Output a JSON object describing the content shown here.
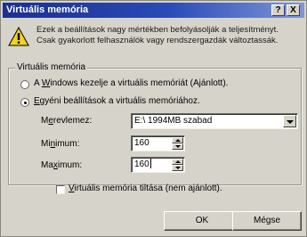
{
  "window": {
    "title": "Virtuális memória",
    "help_button": "?",
    "close_button": "X"
  },
  "message": {
    "icon": "warning-icon",
    "text": "Ezek a beállítások nagy mértékben befolyásolják a teljesítményt. Csak gyakorlott felhasználók vagy rendszergazdák változtassák."
  },
  "group": {
    "title": "Virtuális memória",
    "option_windows_pre": "A ",
    "option_windows_key": "W",
    "option_windows_post": "indows kezelje a virtuális memóriát (Ajánlott).",
    "option_custom_key": "E",
    "option_custom_post": "gyéni beállítások a virtuális memóriához.",
    "selected_option": "custom"
  },
  "fields": {
    "disk_label_pre": "M",
    "disk_label_key": "e",
    "disk_label_post": "revlemez:",
    "disk_value": "E:\\ 1994MB szabad",
    "min_label_pre": "Mi",
    "min_label_key": "n",
    "min_label_post": "imum:",
    "min_value": "160",
    "max_label_pre": "Ma",
    "max_label_key": "x",
    "max_label_post": "imum:",
    "max_value": "160"
  },
  "disable_checkbox": {
    "label_key": "V",
    "label_post": "irtuális memória tiltása (nem ajánlott).",
    "checked": false
  },
  "buttons": {
    "ok": "OK",
    "cancel": "Mégse"
  }
}
